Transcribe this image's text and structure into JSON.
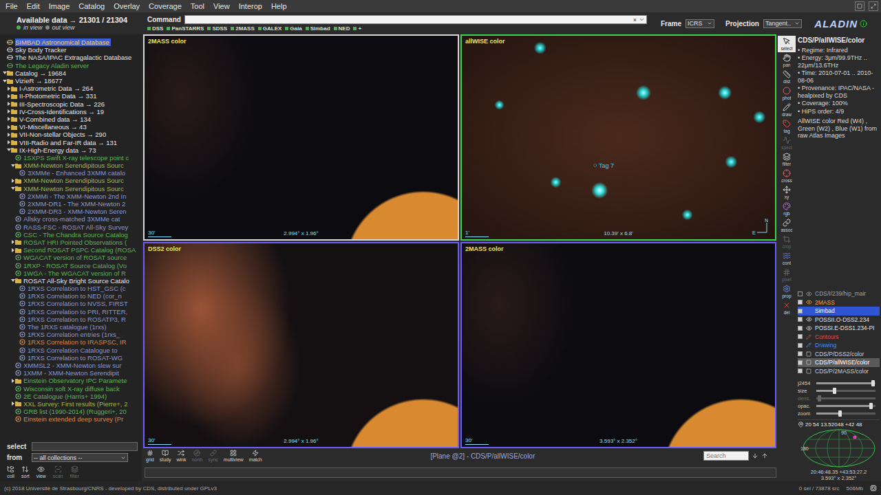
{
  "menu": [
    "File",
    "Edit",
    "Image",
    "Catalog",
    "Overlay",
    "Coverage",
    "Tool",
    "View",
    "Interop",
    "Help"
  ],
  "header": {
    "available": "Available data → 21301 / 21304",
    "in_view": "in view",
    "out_view": "out view",
    "command_label": "Command",
    "command_value": "",
    "clear": "×",
    "frame_label": "Frame",
    "frame_value": "ICRS",
    "projection_label": "Projection",
    "projection_value": "Tangent..",
    "logo": "ALADIN"
  },
  "quick": [
    "DSS",
    "PanSTARRS",
    "SDSS",
    "2MASS",
    "GALEX",
    "Gaia",
    "Simbad",
    "NED",
    "+"
  ],
  "tree": [
    {
      "text": "SIMBAD Astronomical Database",
      "level": 0,
      "kind": "server",
      "selected": true,
      "color": "#f2d47a"
    },
    {
      "text": "Sky Body Tracker",
      "level": 0,
      "kind": "server",
      "selected": false,
      "color": "#e6e6e6"
    },
    {
      "text": "The NASA/IPAC Extragalactic Database",
      "level": 0,
      "kind": "server",
      "selected": false,
      "color": "#e6e6e6"
    },
    {
      "text": "The Legacy Aladin server",
      "level": 0,
      "kind": "server",
      "selected": false,
      "color": "#5fb05a"
    },
    {
      "text": "Catalog → 19684",
      "level": 0,
      "kind": "folder",
      "expanded": true,
      "selected": false,
      "color": "#e6e6e6"
    },
    {
      "text": "VizieR → 18677",
      "level": 0,
      "kind": "folder",
      "expanded": true,
      "selected": false,
      "color": "#e6e6e6"
    },
    {
      "text": "I-Astrometric Data → 264",
      "level": 1,
      "kind": "folder",
      "expanded": false,
      "selected": false,
      "color": "#e6e6e6"
    },
    {
      "text": "II-Photometric Data → 331",
      "level": 1,
      "kind": "folder",
      "expanded": false,
      "selected": false,
      "color": "#e6e6e6"
    },
    {
      "text": "III-Spectroscopic Data → 226",
      "level": 1,
      "kind": "folder",
      "expanded": false,
      "selected": false,
      "color": "#e6e6e6"
    },
    {
      "text": "IV-Cross-Identifications → 19",
      "level": 1,
      "kind": "folder",
      "expanded": false,
      "selected": false,
      "color": "#e6e6e6"
    },
    {
      "text": "V-Combined data → 134",
      "level": 1,
      "kind": "folder",
      "expanded": false,
      "selected": false,
      "color": "#e6e6e6"
    },
    {
      "text": "VI-Miscellaneous → 43",
      "level": 1,
      "kind": "folder",
      "expanded": false,
      "selected": false,
      "color": "#e6e6e6"
    },
    {
      "text": "VII-Non-stellar Objects → 290",
      "level": 1,
      "kind": "folder",
      "expanded": false,
      "selected": false,
      "color": "#e6e6e6"
    },
    {
      "text": "VIII-Radio and Far-IR data → 131",
      "level": 1,
      "kind": "folder",
      "expanded": false,
      "selected": false,
      "color": "#e6e6e6"
    },
    {
      "text": "IX-High-Energy data → 73",
      "level": 1,
      "kind": "folder",
      "expanded": true,
      "selected": false,
      "color": "#e6e6e6"
    },
    {
      "text": "1SXPS Swift X-ray telescope point c",
      "level": 2,
      "kind": "collection",
      "selected": false,
      "color": "#5fb05a"
    },
    {
      "text": "XMM-Newton Serendipitous Sourc",
      "level": 2,
      "kind": "folder",
      "expanded": true,
      "selected": false,
      "color": "#9fb84a"
    },
    {
      "text": "3XMMe - Enhanced 3XMM catalo",
      "level": 3,
      "kind": "collection",
      "selected": false,
      "color": "#8c96cc"
    },
    {
      "text": "XMM-Newton Serendipitous Sourc",
      "level": 2,
      "kind": "folder",
      "expanded": false,
      "selected": false,
      "color": "#9fb84a"
    },
    {
      "text": "XMM-Newton Serendipitous Sourc",
      "level": 2,
      "kind": "folder",
      "expanded": true,
      "selected": false,
      "color": "#9fb84a"
    },
    {
      "text": "2XMMi - The XMM-Newton 2nd In",
      "level": 3,
      "kind": "collection",
      "selected": false,
      "color": "#8c96cc"
    },
    {
      "text": "2XMM-DR1 - The XMM-Newton 2",
      "level": 3,
      "kind": "collection",
      "selected": false,
      "color": "#8c96cc"
    },
    {
      "text": "2XMM-DR3 - XMM-Newton Seren",
      "level": 3,
      "kind": "collection",
      "selected": false,
      "color": "#8c96cc"
    },
    {
      "text": "Allsky cross-matched 3XMMe cat",
      "level": 2,
      "kind": "collection",
      "selected": false,
      "color": "#8c96cc"
    },
    {
      "text": "RASS-FSC - ROSAT All-Sky Survey",
      "level": 2,
      "kind": "collection",
      "selected": false,
      "color": "#8c96cc"
    },
    {
      "text": "CSC - The Chandra Source Catalog",
      "level": 2,
      "kind": "collection",
      "selected": false,
      "color": "#5fb05a"
    },
    {
      "text": "ROSAT HRI Pointed Observations (",
      "level": 2,
      "kind": "folder",
      "expanded": false,
      "selected": false,
      "color": "#5fb05a"
    },
    {
      "text": "Second ROSAT PSPC Catalog (ROSA",
      "level": 2,
      "kind": "folder",
      "expanded": false,
      "selected": false,
      "color": "#5fb05a"
    },
    {
      "text": "WGACAT version of ROSAT source",
      "level": 2,
      "kind": "collection",
      "selected": false,
      "color": "#5fb05a"
    },
    {
      "text": "1RXP - ROSAT Source Catalog (Vo",
      "level": 2,
      "kind": "collection",
      "selected": false,
      "color": "#5fb05a"
    },
    {
      "text": "1WGA - The WGACAT version of R",
      "level": 2,
      "kind": "collection",
      "selected": false,
      "color": "#5fb05a"
    },
    {
      "text": "ROSAT All-Sky Bright Source Catalo",
      "level": 2,
      "kind": "folder",
      "expanded": true,
      "selected": false,
      "color": "#e6e6e6"
    },
    {
      "text": "1RXS Correlation to HST_GSC (c",
      "level": 3,
      "kind": "collection",
      "selected": false,
      "color": "#8c96cc"
    },
    {
      "text": "1RXS Correlation to NED (cor_n",
      "level": 3,
      "kind": "collection",
      "selected": false,
      "color": "#8c96cc"
    },
    {
      "text": "1RXS Correlation to NVSS, FIRST",
      "level": 3,
      "kind": "collection",
      "selected": false,
      "color": "#8c96cc"
    },
    {
      "text": "1RXS Correlation to PRI, RITTER,",
      "level": 3,
      "kind": "collection",
      "selected": false,
      "color": "#8c96cc"
    },
    {
      "text": "1RXS Correlation to ROSATP3, R",
      "level": 3,
      "kind": "collection",
      "selected": false,
      "color": "#8c96cc"
    },
    {
      "text": "The 1RXS catalogue (1rxs)",
      "level": 3,
      "kind": "collection",
      "selected": false,
      "color": "#8c96cc"
    },
    {
      "text": "1RXS Correlation entries (1rxs_",
      "level": 3,
      "kind": "collection",
      "selected": false,
      "color": "#8c96cc"
    },
    {
      "text": "1RXS Correlation to IRASPSC, IR",
      "level": 3,
      "kind": "collection",
      "selected": false,
      "color": "#d8884a"
    },
    {
      "text": "1RXS Correlation Catalogue to",
      "level": 3,
      "kind": "collection",
      "selected": false,
      "color": "#8c96cc"
    },
    {
      "text": "1RXS Correlation to ROSAT-WG",
      "level": 3,
      "kind": "collection",
      "selected": false,
      "color": "#8c96cc"
    },
    {
      "text": "XMMSL2 - XMM-Newton slew sur",
      "level": 2,
      "kind": "collection",
      "selected": false,
      "color": "#8c96cc"
    },
    {
      "text": "1XMM - XMM-Newton Serendipit",
      "level": 2,
      "kind": "collection",
      "selected": false,
      "color": "#8c96cc"
    },
    {
      "text": "Einstein Observatory IPC Paramete",
      "level": 2,
      "kind": "folder",
      "expanded": false,
      "selected": false,
      "color": "#5fb05a"
    },
    {
      "text": "Wisconsin soft X-ray diffuse back",
      "level": 2,
      "kind": "collection",
      "selected": false,
      "color": "#5fb05a"
    },
    {
      "text": "2E Catalogue (Harris+ 1994)",
      "level": 2,
      "kind": "collection",
      "selected": false,
      "color": "#5fb05a"
    },
    {
      "text": "XXL Survey: First results (Pierre+, 2",
      "level": 2,
      "kind": "folder",
      "expanded": false,
      "selected": false,
      "color": "#9fb84a"
    },
    {
      "text": "GRB list (1990-2014) (Ruggeri+, 20",
      "level": 2,
      "kind": "collection",
      "selected": false,
      "color": "#5fb05a"
    },
    {
      "text": "Einstein extended deep survey (Pr",
      "level": 2,
      "kind": "collection",
      "selected": false,
      "color": "#d8884a"
    }
  ],
  "left_bottom": {
    "select_label": "select",
    "select_value": "",
    "from_label": "from",
    "from_value": "-- all collections --",
    "buttons": [
      {
        "label": "coll",
        "disabled": false
      },
      {
        "label": "sort",
        "disabled": false
      },
      {
        "label": "view",
        "disabled": false
      },
      {
        "label": "scan",
        "disabled": true
      },
      {
        "label": "filter",
        "disabled": true
      }
    ]
  },
  "views": [
    {
      "title": "2MASS color",
      "kind": "2mass",
      "selected": false,
      "color": "#d8d8d8",
      "size": "2.994° x 1.96°",
      "scale": "30'"
    },
    {
      "title": "allWISE color",
      "kind": "wise",
      "selected": true,
      "color": "#3ad44f",
      "size": "10.39' x 6.8'",
      "scale": "1'",
      "tag": "Tag 7",
      "north": "N",
      "east": "E"
    },
    {
      "title": "DSS2 color",
      "kind": "dss",
      "selected": false,
      "color": "#6d5cff",
      "size": "2.994° x 1.96°",
      "scale": "30'"
    },
    {
      "title": "2MASS color",
      "kind": "2mass",
      "selected": false,
      "color": "#6d5cff",
      "size": "3.593° x 2.352°",
      "scale": "30'"
    }
  ],
  "bottom_bar": {
    "buttons": [
      {
        "label": "grid",
        "disabled": false
      },
      {
        "label": "study",
        "disabled": false
      },
      {
        "label": "wink",
        "disabled": false
      },
      {
        "label": "north",
        "disabled": true
      },
      {
        "label": "sync",
        "disabled": true
      },
      {
        "label": "multiview",
        "disabled": false
      },
      {
        "label": "match",
        "disabled": false
      }
    ],
    "status": "[Plane @2] - CDS/P/allWISE/color",
    "search_placeholder": "Search",
    "info_value": ""
  },
  "tools": [
    {
      "label": "select",
      "selected": true,
      "disabled": false,
      "color": "#d8d8d8"
    },
    {
      "label": "pan",
      "selected": false,
      "disabled": false,
      "color": "#d8d8d8"
    },
    {
      "label": "dist",
      "selected": false,
      "disabled": false,
      "color": "#d8d8d8"
    },
    {
      "label": "phot",
      "selected": false,
      "disabled": false,
      "color": "#e06060"
    },
    {
      "label": "draw",
      "selected": false,
      "disabled": false,
      "color": "#d8d8d8"
    },
    {
      "label": "tag",
      "selected": false,
      "disabled": false,
      "color": "#e06060"
    },
    {
      "label": "spect",
      "selected": false,
      "disabled": true,
      "color": "#d8d8d8"
    },
    {
      "label": "filter",
      "selected": false,
      "disabled": false,
      "color": "#d8d8d8"
    },
    {
      "label": "cross",
      "selected": false,
      "disabled": false,
      "color": "#e06060"
    },
    {
      "label": "xy",
      "selected": false,
      "disabled": false,
      "color": "#d8d8d8"
    },
    {
      "label": "rgb",
      "selected": false,
      "disabled": false,
      "color": "#c070e0"
    },
    {
      "label": "assoc",
      "selected": false,
      "disabled": false,
      "color": "#d8d8d8"
    },
    {
      "label": "crop",
      "selected": false,
      "disabled": true,
      "color": "#d8d8d8"
    },
    {
      "label": "cont",
      "selected": false,
      "disabled": false,
      "color": "#6a8ae8"
    },
    {
      "label": "pixel",
      "selected": false,
      "disabled": true,
      "color": "#d8d8d8"
    },
    {
      "label": "prop",
      "selected": false,
      "disabled": false,
      "color": "#6a8ae8"
    },
    {
      "label": "del",
      "selected": false,
      "disabled": false,
      "color": "#e23b3b"
    }
  ],
  "info": {
    "title": "CDS/P/allWISE/color",
    "lines": [
      "• Regime: Infrared",
      "• Energy: 3μm/99.9THz .. 22μm/13.6THz",
      "• Time: 2010-07-01 .. 2010-08-06",
      "• Provenance: IPAC/NASA - healpixed by CDS",
      "• Coverage: 100%",
      "• HiPS order: 4/9"
    ],
    "description": "AllWISE color Red (W4) , Green (W2) , Blue (W1) from raw Atlas Images"
  },
  "layers": [
    {
      "name": "CDS/I/239/hip_mair",
      "kind": "catalog",
      "visible": false,
      "selected": false,
      "color": "#a0a0a0"
    },
    {
      "name": "2MASS",
      "kind": "catalog",
      "visible": true,
      "selected": false,
      "color": "#f0a040"
    },
    {
      "name": "Simbad",
      "kind": "catalog",
      "visible": true,
      "selected": true,
      "color": "#2b5ce6"
    },
    {
      "name": "POSSII.O-DSS2.234",
      "kind": "catalog",
      "visible": true,
      "selected": false,
      "color": "#e6e6e6"
    },
    {
      "name": "POSSI.E-DSS1.234-PI",
      "kind": "catalog",
      "visible": true,
      "selected": false,
      "color": "#e6e6e6"
    },
    {
      "name": "Contours",
      "kind": "overlay",
      "visible": true,
      "selected": false,
      "color": "#e04848"
    },
    {
      "name": "Drawing",
      "kind": "overlay",
      "visible": true,
      "selected": false,
      "color": "#4a8ae0"
    },
    {
      "name": "CDS/P/DSS2/color",
      "kind": "image",
      "visible": true,
      "selected": false,
      "color": "#d0d0d0"
    },
    {
      "name": "CDS/P/allWISE/color",
      "kind": "image",
      "visible": true,
      "selected": true,
      "color": "#d0d0d0"
    },
    {
      "name": "CDS/P/2MASS/color",
      "kind": "image",
      "visible": true,
      "selected": false,
      "color": "#d0d0d0"
    }
  ],
  "sliders": [
    {
      "label": "j2454",
      "level": 0.95,
      "disabled": false
    },
    {
      "label": "size",
      "level": 0.3,
      "disabled": false
    },
    {
      "label": "dens.",
      "level": 0.05,
      "disabled": true
    },
    {
      "label": "opac.",
      "level": 0.92,
      "disabled": false
    },
    {
      "label": "zoom",
      "level": 0.4,
      "disabled": false
    }
  ],
  "minimap": {
    "coord": "20 54 13.52048 +42 48",
    "labels": [
      "180",
      "90"
    ],
    "center": "20:46:48.35 +43:53:27.2",
    "fov": "3.593° x 2.352°"
  },
  "footer": {
    "copyright": "(c) 2018 Université de Strasbourg/CNRS - developed by CDS, distributed under GPLv3",
    "selection": "0 sel / 73878 src",
    "memory": "506Mb"
  }
}
